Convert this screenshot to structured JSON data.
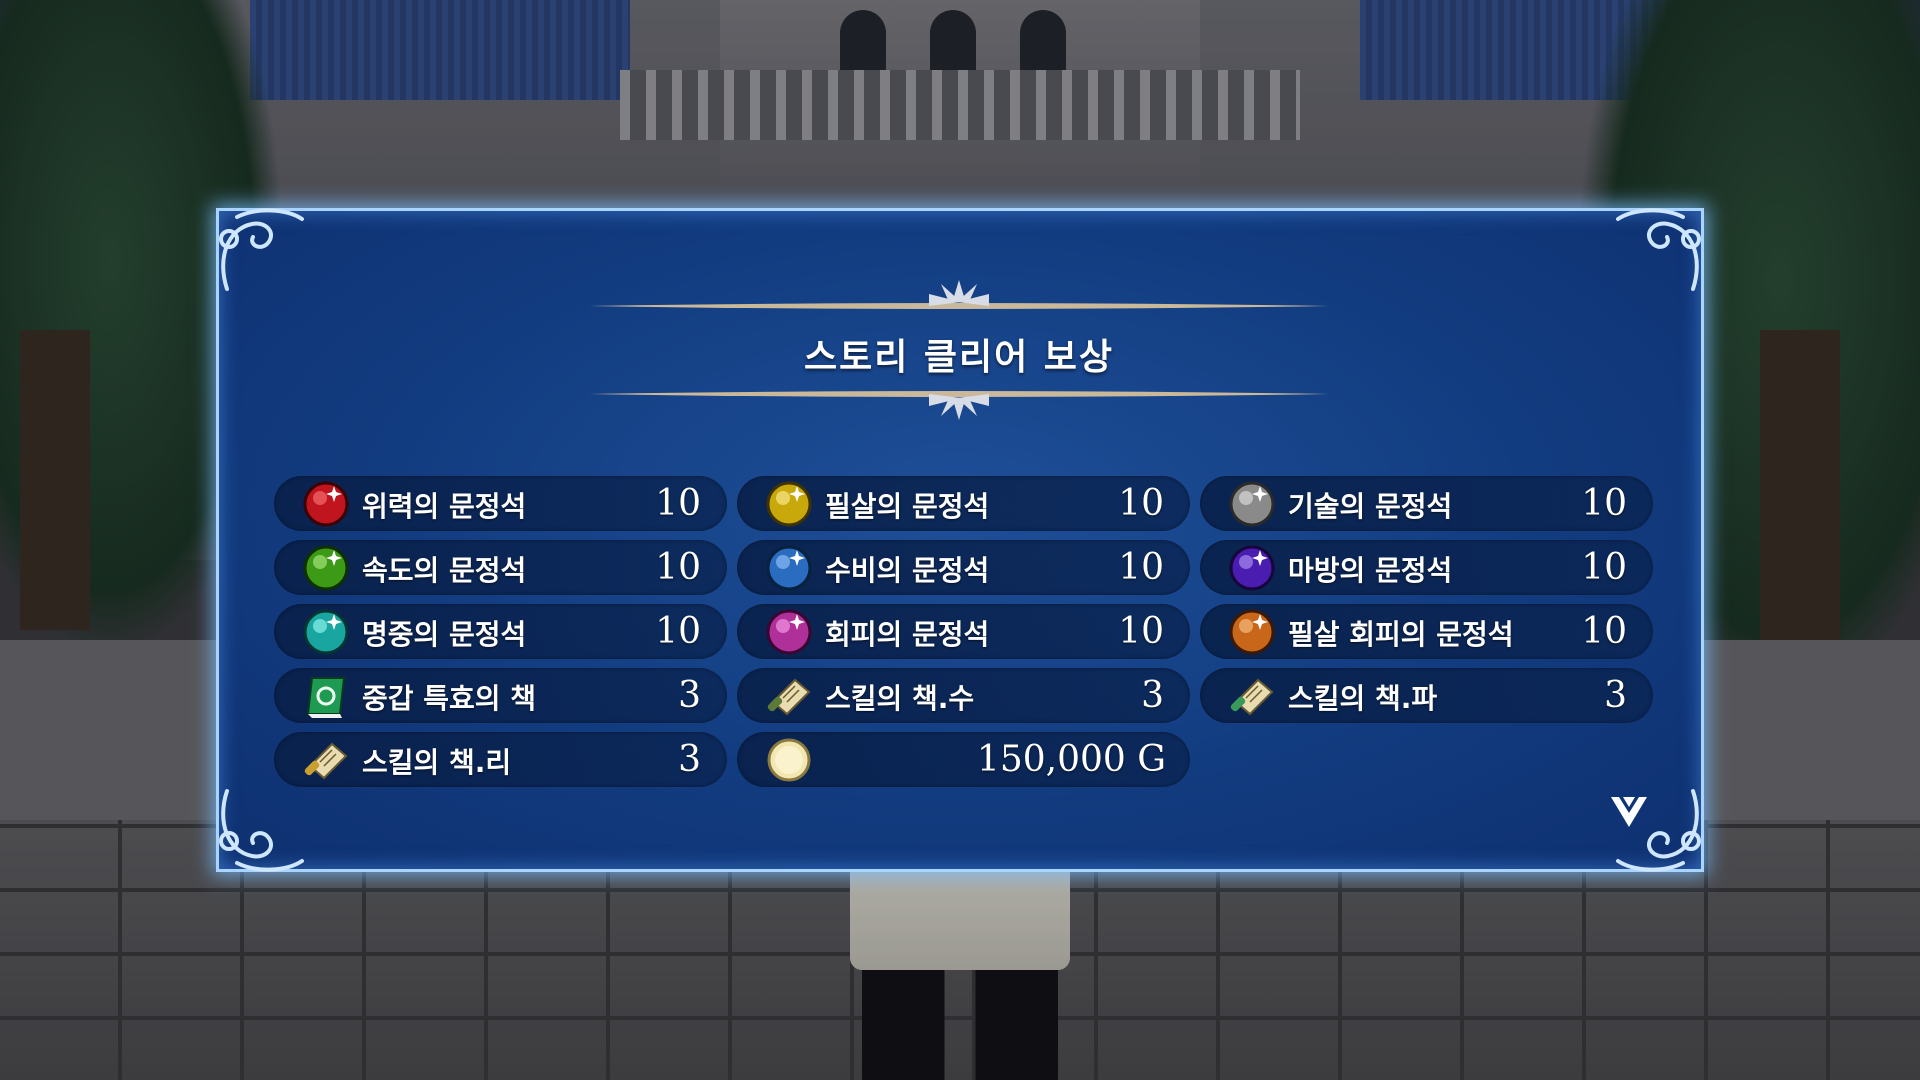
{
  "dialog": {
    "title": "스토리 클리어 보상",
    "next_icon": "chevron-down-icon"
  },
  "rewards": [
    {
      "name": "위력의 문정석",
      "qty": "10",
      "icon": "red-gem-icon",
      "color": "#c0141e"
    },
    {
      "name": "필살의 문정석",
      "qty": "10",
      "icon": "yellow-gem-icon",
      "color": "#c9a80c"
    },
    {
      "name": "기술의 문정석",
      "qty": "10",
      "icon": "gray-gem-icon",
      "color": "#8a8a8a"
    },
    {
      "name": "속도의 문정석",
      "qty": "10",
      "icon": "green-gem-icon",
      "color": "#3d9a16"
    },
    {
      "name": "수비의 문정석",
      "qty": "10",
      "icon": "blue-gem-icon",
      "color": "#2a6cc0"
    },
    {
      "name": "마방의 문정석",
      "qty": "10",
      "icon": "purple-gem-icon",
      "color": "#4b1cb0"
    },
    {
      "name": "명중의 문정석",
      "qty": "10",
      "icon": "teal-gem-icon",
      "color": "#1aa6a0"
    },
    {
      "name": "회피의 문정석",
      "qty": "10",
      "icon": "magenta-gem-icon",
      "color": "#b0309a"
    },
    {
      "name": "필살 회피의 문정석",
      "qty": "10",
      "icon": "orange-gem-icon",
      "color": "#c8661a"
    },
    {
      "name": "중갑 특효의 책",
      "qty": "3",
      "icon": "green-book-icon",
      "color": "#1f9a52"
    },
    {
      "name": "스킬의 책.수",
      "qty": "3",
      "icon": "scroll-icon",
      "color": "#e8dcb0"
    },
    {
      "name": "스킬의 책.파",
      "qty": "3",
      "icon": "scroll-icon",
      "color": "#e8dcb0"
    },
    {
      "name": "스킬의 책.리",
      "qty": "3",
      "icon": "scroll-icon",
      "color": "#e8dcb0"
    },
    {
      "name": "",
      "qty": "150,000 G",
      "icon": "gold-coin-icon",
      "color": "#f2e7b0"
    }
  ]
}
